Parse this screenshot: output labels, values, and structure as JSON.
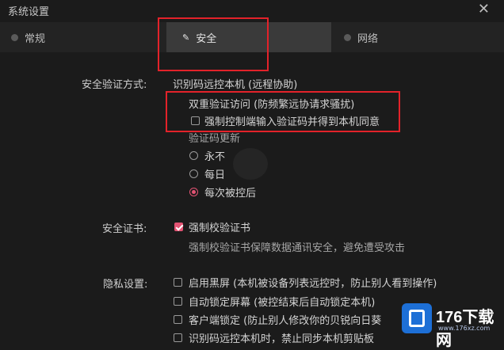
{
  "window": {
    "title": "系统设置"
  },
  "tabs": [
    {
      "label": "常规"
    },
    {
      "label": "安全"
    },
    {
      "label": "网络"
    }
  ],
  "security": {
    "auth_method_label": "安全验证方式:",
    "auth_method_value": "识别码远控本机 (远程协助)",
    "dual_verify_title": "双重验证访问 (防频繁远协请求骚扰)",
    "force_code_label": "强制控制端输入验证码并得到本机同意",
    "force_code_checked": false,
    "code_update_label": "验证码更新",
    "code_update_options": [
      {
        "label": "永不",
        "selected": false
      },
      {
        "label": "每日",
        "selected": false
      },
      {
        "label": "每次被控后",
        "selected": true
      }
    ],
    "cert_label": "安全证书:",
    "cert_checkbox_label": "强制校验证书",
    "cert_checked": true,
    "cert_desc": "强制校验证书保障数据通讯安全，避免遭受攻击"
  },
  "privacy": {
    "label": "隐私设置:",
    "options": [
      {
        "label": "启用黑屏 (本机被设备列表远控时，防止别人看到操作)",
        "checked": false
      },
      {
        "label": "自动锁定屏幕 (被控结束后自动锁定本机)",
        "checked": false
      },
      {
        "label": "客户端锁定 (防止别人修改你的贝锐向日葵",
        "checked": false
      },
      {
        "label": "识别码远控本机时，禁止同步本机剪贴板",
        "checked": false
      }
    ]
  },
  "watermark": {
    "brand": "176下载网",
    "url": "www.176xz.com"
  },
  "colors": {
    "accent": "#e35373",
    "highlight_box": "#e3222a",
    "background": "#1b1b1b"
  }
}
